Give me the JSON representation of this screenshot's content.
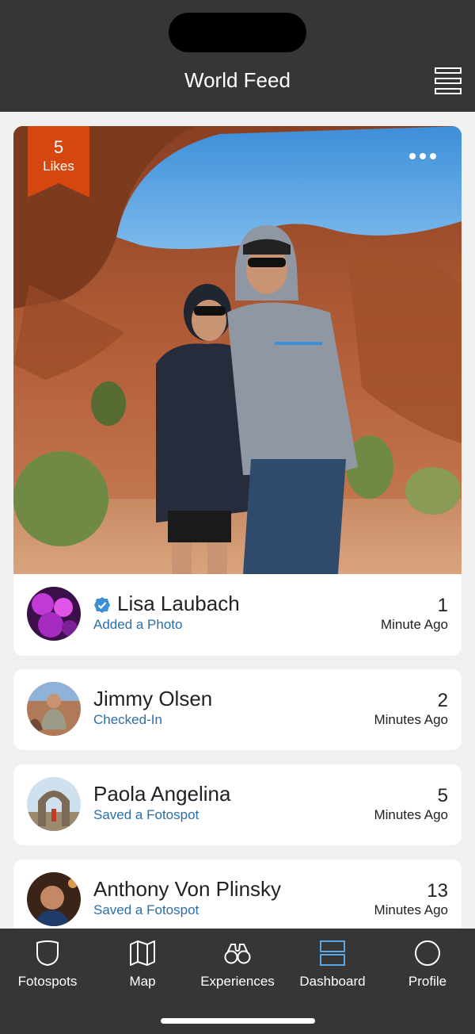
{
  "header": {
    "title": "World Feed",
    "menu_icon": "list-menu-icon"
  },
  "post": {
    "likes_count": "5",
    "likes_label": "Likes",
    "more_icon": "more-dots-icon",
    "author": {
      "name": "Lisa Laubach",
      "verified": true,
      "action": "Added a Photo",
      "time_value": "1",
      "time_unit": "Minute Ago"
    }
  },
  "entries": [
    {
      "name": "Jimmy Olsen",
      "action": "Checked-In",
      "time_value": "2",
      "time_unit": "Minutes Ago"
    },
    {
      "name": "Paola Angelina",
      "action": "Saved a Fotospot",
      "time_value": "5",
      "time_unit": "Minutes Ago"
    },
    {
      "name": "Anthony Von Plinsky",
      "action": "Saved a Fotospot",
      "time_value": "13",
      "time_unit": "Minutes Ago"
    }
  ],
  "nav": [
    {
      "label": "Fotospots",
      "icon": "shield-icon",
      "active": false
    },
    {
      "label": "Map",
      "icon": "map-icon",
      "active": false
    },
    {
      "label": "Experiences",
      "icon": "binoculars-icon",
      "active": false
    },
    {
      "label": "Dashboard",
      "icon": "dashboard-icon",
      "active": true
    },
    {
      "label": "Profile",
      "icon": "profile-circle-icon",
      "active": false
    }
  ],
  "colors": {
    "header_bg": "#363636",
    "likes_ribbon": "#d6470f",
    "action_text": "#2b6ea8",
    "verified_badge": "#3b8fd6",
    "nav_active": "#5aa8e6"
  }
}
